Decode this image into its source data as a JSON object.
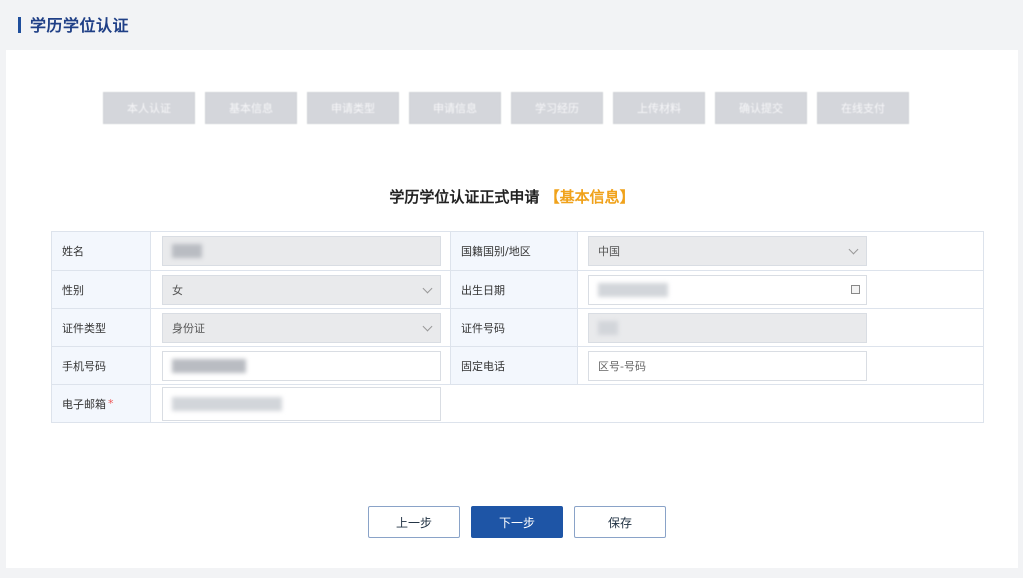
{
  "header": {
    "title": "学历学位认证"
  },
  "steps": [
    "本人认证",
    "基本信息",
    "申请类型",
    "申请信息",
    "学习经历",
    "上传材料",
    "确认提交",
    "在线支付"
  ],
  "form": {
    "title": "学历学位认证正式申请",
    "subtitle": "【基本信息】",
    "fields": {
      "name": {
        "label": "姓名",
        "value": ""
      },
      "nationality": {
        "label": "国籍国别/地区",
        "value": "中国"
      },
      "gender": {
        "label": "性别",
        "value": "女"
      },
      "birthdate": {
        "label": "出生日期",
        "value": ""
      },
      "id_type": {
        "label": "证件类型",
        "value": "身份证"
      },
      "id_number": {
        "label": "证件号码",
        "value": ""
      },
      "mobile": {
        "label": "手机号码",
        "value": ""
      },
      "landline": {
        "label": "固定电话",
        "placeholder": "区号-号码"
      },
      "email": {
        "label": "电子邮箱",
        "required_mark": "*",
        "value": ""
      }
    }
  },
  "buttons": {
    "prev": "上一步",
    "next": "下一步",
    "save": "保存"
  },
  "colors": {
    "accent": "#1e55a6",
    "title_blue": "#1f3f86",
    "subtitle_orange": "#f0a21b"
  }
}
